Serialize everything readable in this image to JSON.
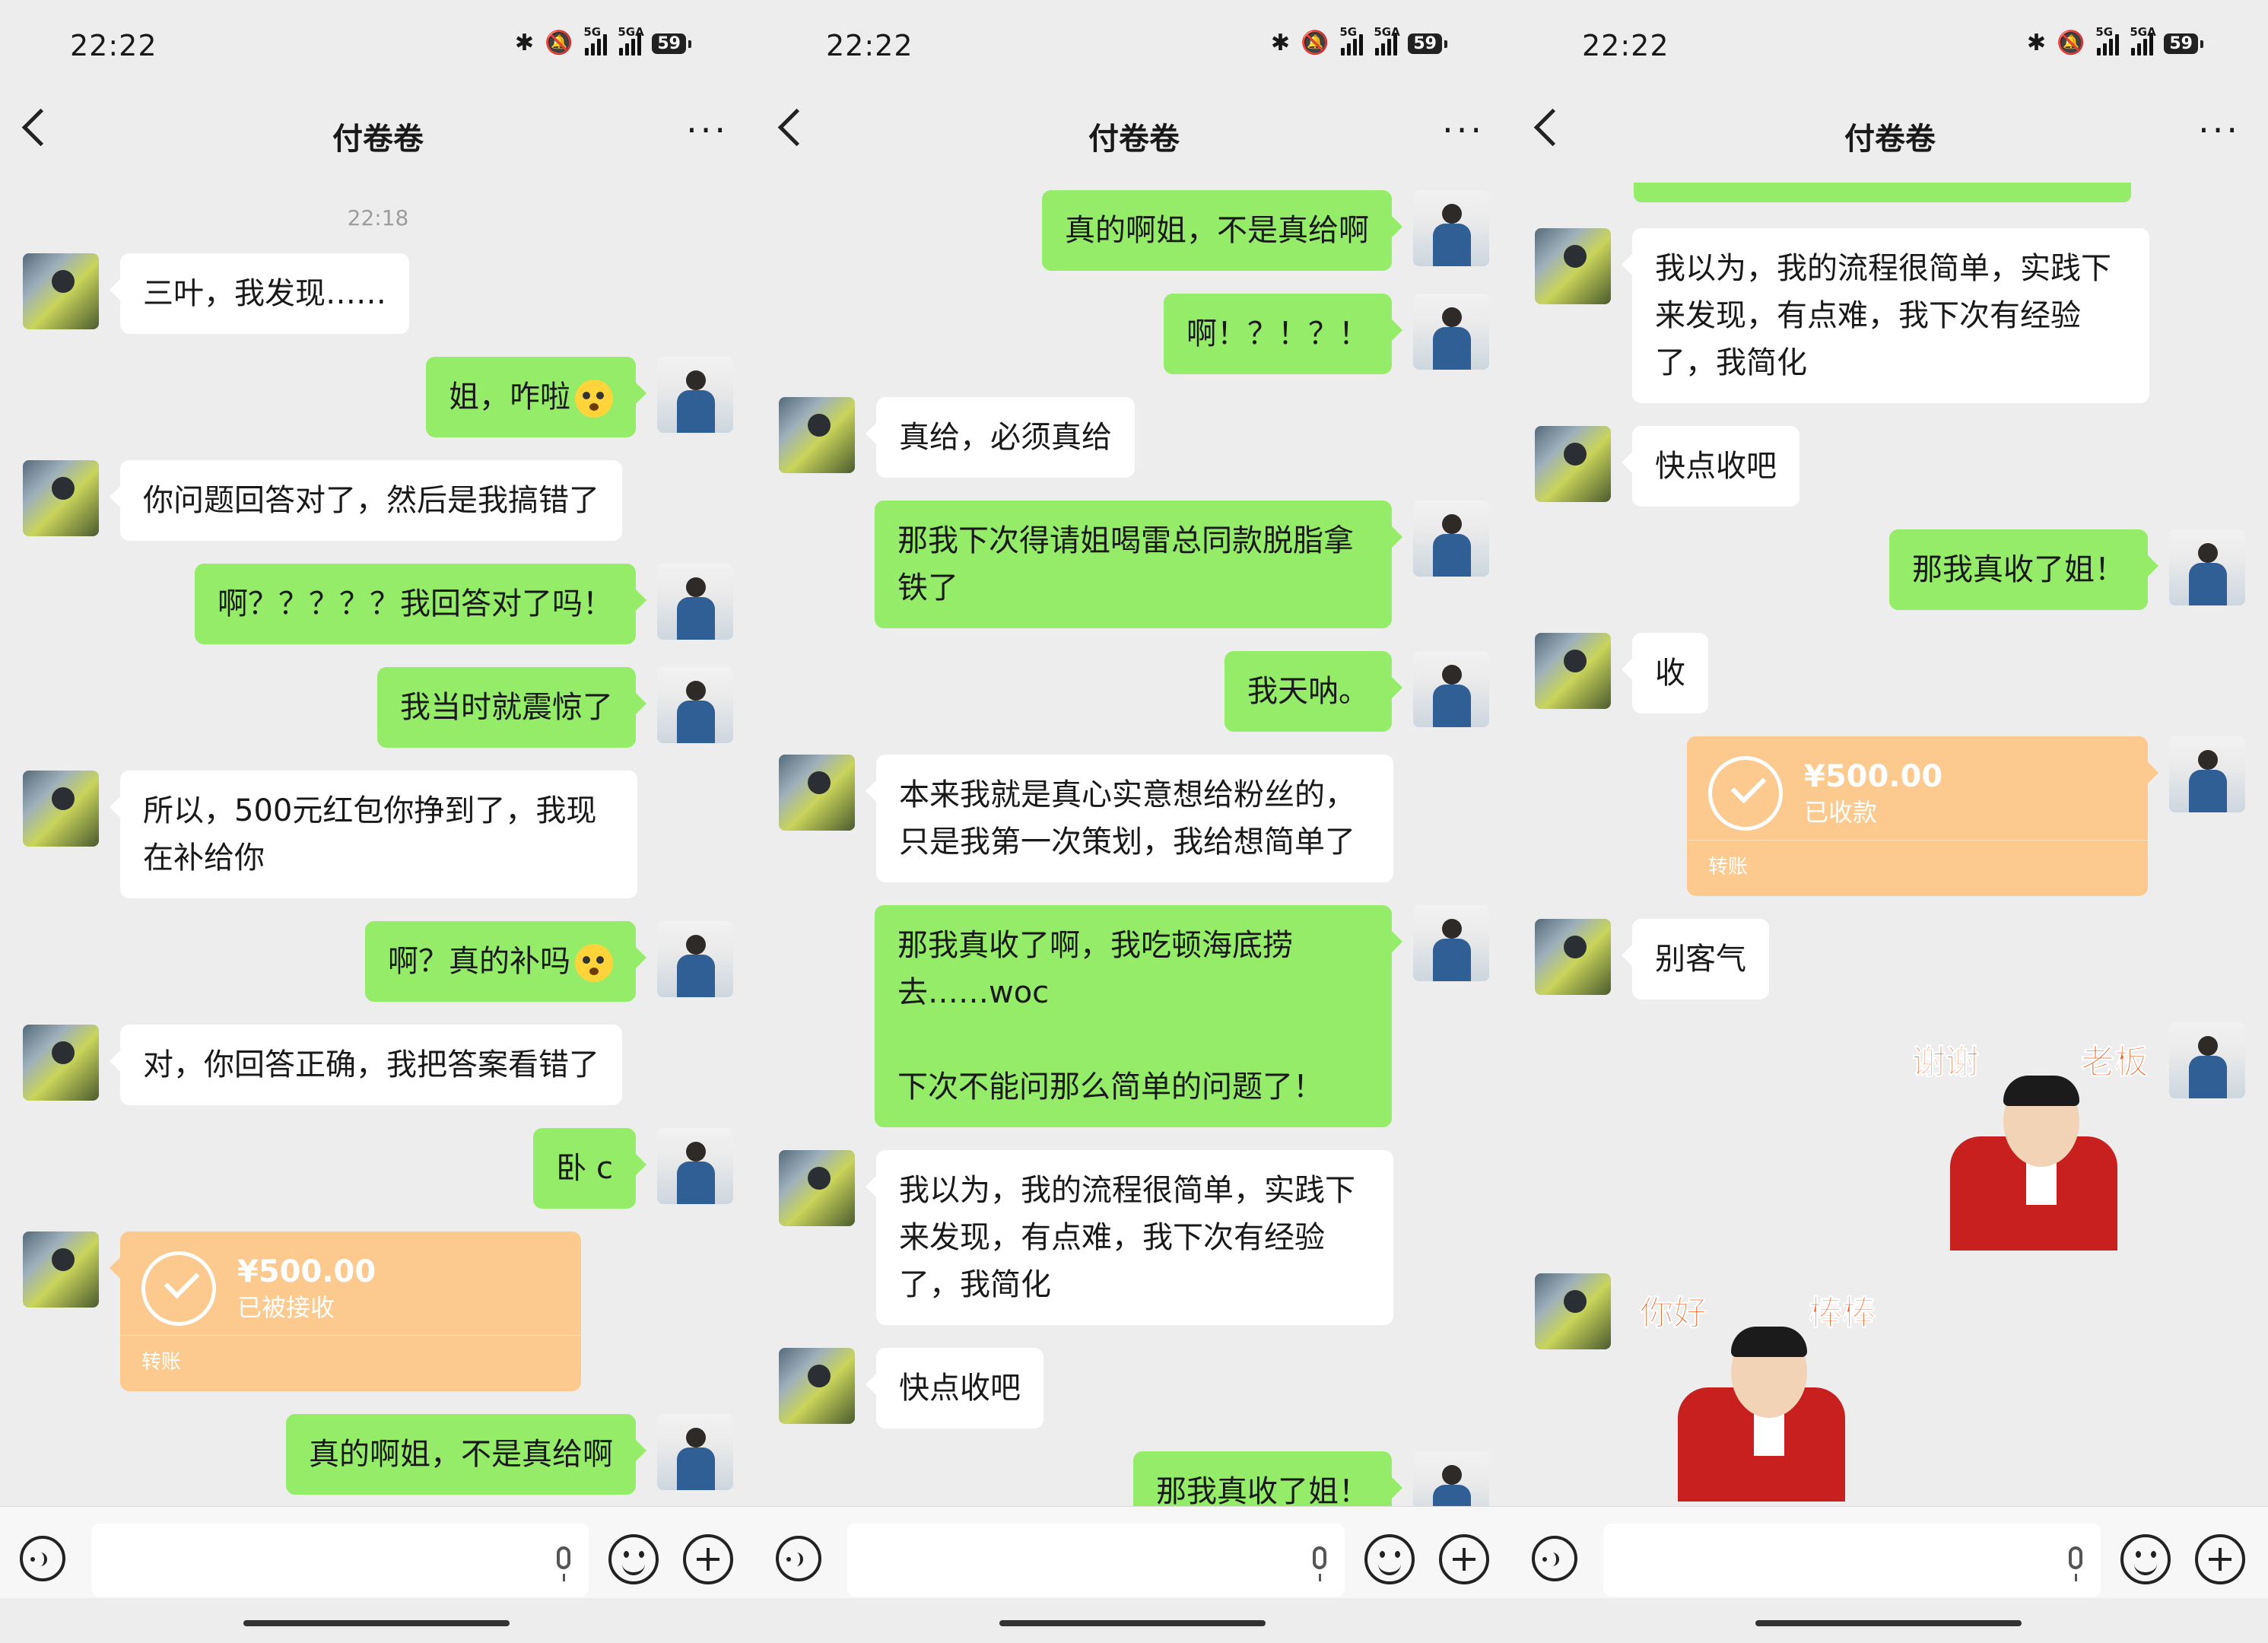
{
  "status": {
    "time": "22:22",
    "network1": "5G",
    "network2": "5GA",
    "battery": "59"
  },
  "contact": {
    "name": "付卷卷"
  },
  "screens": [
    {
      "timestamp": "22:18",
      "messages": [
        {
          "side": "left",
          "type": "text",
          "text": "三叶，我发现……"
        },
        {
          "side": "right",
          "type": "text",
          "text": "姐，咋啦",
          "emoji": "shocked-emoji"
        },
        {
          "side": "left",
          "type": "text",
          "text": "你问题回答对了，然后是我搞错了"
        },
        {
          "side": "right",
          "type": "text",
          "text": "啊？？？？？我回答对了吗！"
        },
        {
          "side": "right",
          "type": "text",
          "text": "我当时就震惊了"
        },
        {
          "side": "left",
          "type": "text",
          "text": "所以，500元红包你挣到了，我现在补给你"
        },
        {
          "side": "right",
          "type": "text",
          "text": "啊？真的补吗",
          "emoji": "flushed-emoji"
        },
        {
          "side": "left",
          "type": "text",
          "text": "对，你回答正确，我把答案看错了"
        },
        {
          "side": "right",
          "type": "text",
          "text": "卧 c"
        },
        {
          "side": "left",
          "type": "transfer",
          "amount": "¥500.00",
          "status": "已被接收",
          "label": "转账"
        },
        {
          "side": "right",
          "type": "text",
          "text": "真的啊姐，不是真给啊"
        }
      ]
    },
    {
      "timestamp": "",
      "messages": [
        {
          "side": "right",
          "type": "text",
          "text": "真的啊姐，不是真给啊"
        },
        {
          "side": "right",
          "type": "text",
          "text": "啊！？！？！"
        },
        {
          "side": "left",
          "type": "text",
          "text": "真给，必须真给"
        },
        {
          "side": "right",
          "type": "text",
          "text": "那我下次得请姐喝雷总同款脱脂拿铁了"
        },
        {
          "side": "right",
          "type": "text",
          "text": "我天呐。"
        },
        {
          "side": "left",
          "type": "text",
          "text": "本来我就是真心实意想给粉丝的，只是我第一次策划，我给想简单了"
        },
        {
          "side": "right",
          "type": "text",
          "text": "那我真收了啊，我吃顿海底捞去……woc\n\n下次不能问那么简单的问题了！"
        },
        {
          "side": "left",
          "type": "text",
          "text": "我以为，我的流程很简单，实践下来发现，有点难，我下次有经验了，我简化"
        },
        {
          "side": "left",
          "type": "text",
          "text": "快点收吧"
        },
        {
          "side": "right",
          "type": "text",
          "text": "那我真收了姐！"
        }
      ]
    },
    {
      "timestamp": "",
      "messages": [
        {
          "side": "left",
          "type": "text",
          "text": "我以为，我的流程很简单，实践下来发现，有点难，我下次有经验了，我简化"
        },
        {
          "side": "left",
          "type": "text",
          "text": "快点收吧"
        },
        {
          "side": "right",
          "type": "text",
          "text": "那我真收了姐！"
        },
        {
          "side": "left",
          "type": "text",
          "text": "收"
        },
        {
          "side": "right",
          "type": "transfer",
          "amount": "¥500.00",
          "status": "已收款",
          "label": "转账"
        },
        {
          "side": "left",
          "type": "text",
          "text": "别客气"
        },
        {
          "side": "right",
          "type": "sticker",
          "caption_left": "谢谢",
          "caption_right": "老板"
        },
        {
          "side": "left",
          "type": "sticker",
          "caption_left": "你好",
          "caption_right": "棒棒"
        }
      ]
    }
  ],
  "colors": {
    "self_bubble": "#95ec69",
    "other_bubble": "#ffffff",
    "transfer": "#fcc98e",
    "background": "#ededed",
    "sticker_text": "#ef5a1c"
  }
}
